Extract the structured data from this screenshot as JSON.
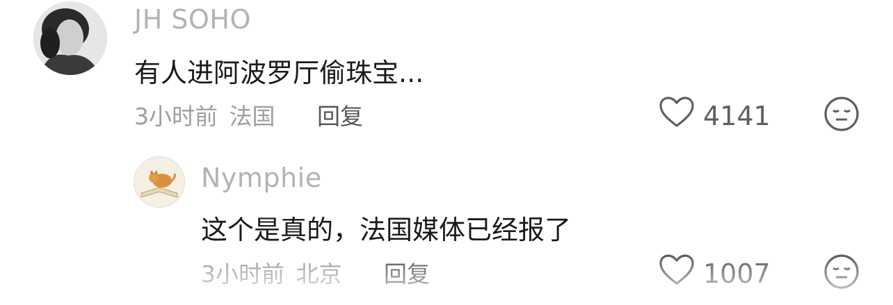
{
  "comments": [
    {
      "username": "JH SOHO",
      "text": "有人进阿波罗厅偷珠宝...",
      "time": "3小时前",
      "location": "法国",
      "reply_label": "回复",
      "likes": "4141"
    },
    {
      "username": "Nymphie",
      "text": "这个是真的，法国媒体已经报了",
      "time": "3小时前",
      "location": "北京",
      "reply_label": "回复",
      "likes": "1007"
    }
  ],
  "icons": {
    "like": "heart-outline-icon",
    "reaction": "neutral-face-icon"
  },
  "colors": {
    "username": "#b3b3b3",
    "meta": "#9e9e9e",
    "text": "#1a1a1a",
    "icon": "#5f5f5f"
  }
}
